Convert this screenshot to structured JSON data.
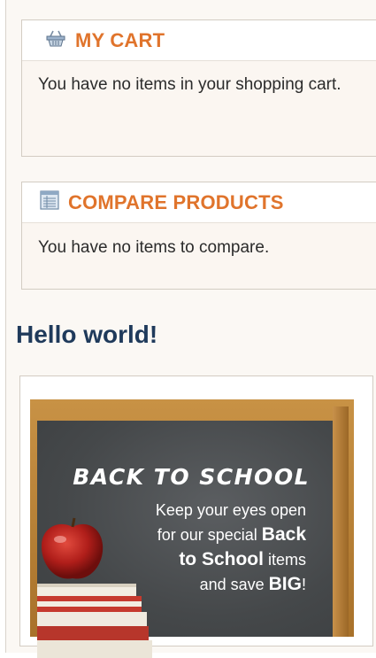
{
  "cart": {
    "title": "MY CART",
    "icon": "basket-icon",
    "message": "You have no items in your shopping cart."
  },
  "compare": {
    "title": "COMPARE PRODUCTS",
    "icon": "list-icon",
    "message": "You have no items to compare."
  },
  "main": {
    "heading": "Hello world!"
  },
  "banner": {
    "headline": "BACK TO SCHOOL",
    "line1": "Keep your eyes open",
    "line2_pre": "for our special ",
    "line2_bold": "Back",
    "line3_bold": "to School",
    "line3_post": " items",
    "line4_pre": "and save ",
    "line4_bold": "BIG",
    "line4_post": "!"
  },
  "colors": {
    "accent": "#e0742c",
    "heading": "#1f3a5b"
  }
}
